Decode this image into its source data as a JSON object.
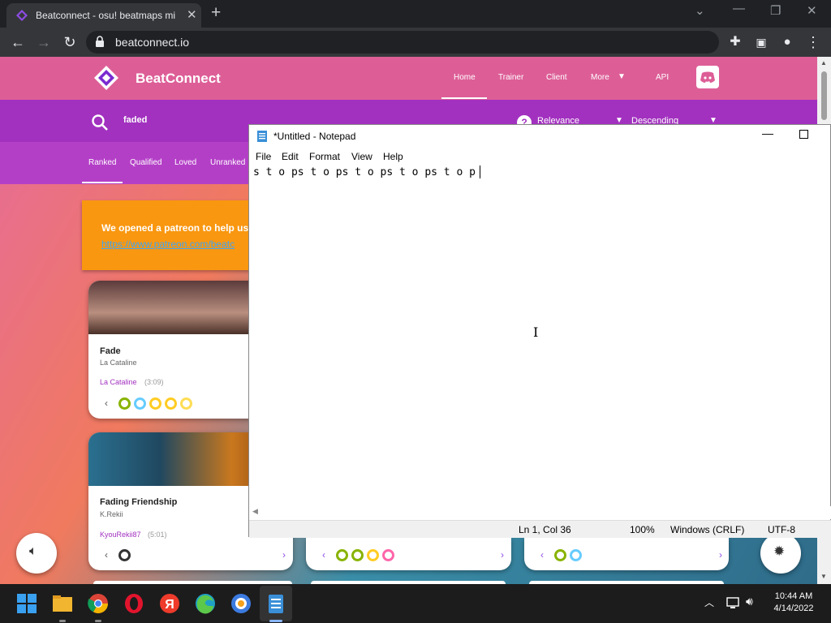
{
  "browser": {
    "tab_title": "Beatconnect - osu! beatmaps mi",
    "url": "beatconnect.io",
    "new_tab": "+",
    "close_tab": "✕"
  },
  "site": {
    "brand": "BeatConnect",
    "nav": [
      "Home",
      "Trainer",
      "Client",
      "More",
      "API"
    ],
    "search_text": "faded",
    "sort_by": "Relevance",
    "sort_order": "Descending",
    "filters": [
      "Ranked",
      "Qualified",
      "Loved",
      "Unranked"
    ],
    "patreon_text": "We opened a patreon to help us",
    "patreon_link": "https://www.patreon.com/beatc",
    "cards": [
      {
        "title": "Fade",
        "artist": "La Cataline",
        "mapper": "La Cataline",
        "length": "(3:09)"
      },
      {
        "title": "Fading Friendship",
        "artist": "K.Rekii",
        "mapper": "KyouRekii87",
        "length": "(5:01)"
      }
    ],
    "colors": {
      "header": "#dd5e97",
      "bar": "#a231bf",
      "patreon": "#f99710"
    }
  },
  "notepad": {
    "title": "*Untitled - Notepad",
    "menu": [
      "File",
      "Edit",
      "Format",
      "View",
      "Help"
    ],
    "content": "s t o ps t o ps t o ps t o ps t o p",
    "status": {
      "position": "Ln 1, Col 36",
      "zoom": "100%",
      "line_ending": "Windows (CRLF)",
      "encoding": "UTF-8"
    }
  },
  "taskbar": {
    "time": "10:44 AM",
    "date": "4/14/2022"
  }
}
